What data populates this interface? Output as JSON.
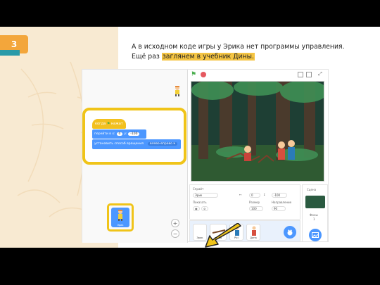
{
  "step": {
    "number": "3"
  },
  "instruction": {
    "line1": "А в исходном коде игры у Эрика нет программы управления.",
    "line2_prefix": "Ещё раз ",
    "line2_highlight": "заглянем в учебник Дины."
  },
  "code": {
    "hat_label": "когда",
    "hat_label2": "нажат",
    "goto_label": "перейти в x:",
    "x_value": "0",
    "y_label": "y:",
    "y_value": "-100",
    "set_label": "установить способ вращения",
    "set_option": "влево-вправо"
  },
  "zoom": {
    "in": "+",
    "out": "−",
    "reset": "="
  },
  "sprite_info": {
    "sprite_label": "Спрайт",
    "sprite_name": "Эрик",
    "show_label": "Показать",
    "x_value": "0",
    "y_value": "-100",
    "size_label": "Размер",
    "size_value": "100",
    "direction_label": "Направление",
    "direction_value": "90"
  },
  "sprites": [
    {
      "label": "Эрик"
    },
    {
      "label": "ветка"
    },
    {
      "label": "Pici"
    },
    {
      "label": "Дина"
    }
  ],
  "stage_pane": {
    "label": "Сцена",
    "backdrops_label": "Фоны",
    "backdrops_count": "1"
  },
  "colors": {
    "accent": "#f3a63b",
    "highlight": "#f0c419",
    "teal": "#2a9aa8",
    "scratch_blue": "#4c97ff",
    "scratch_yellow": "#f2c01f"
  }
}
